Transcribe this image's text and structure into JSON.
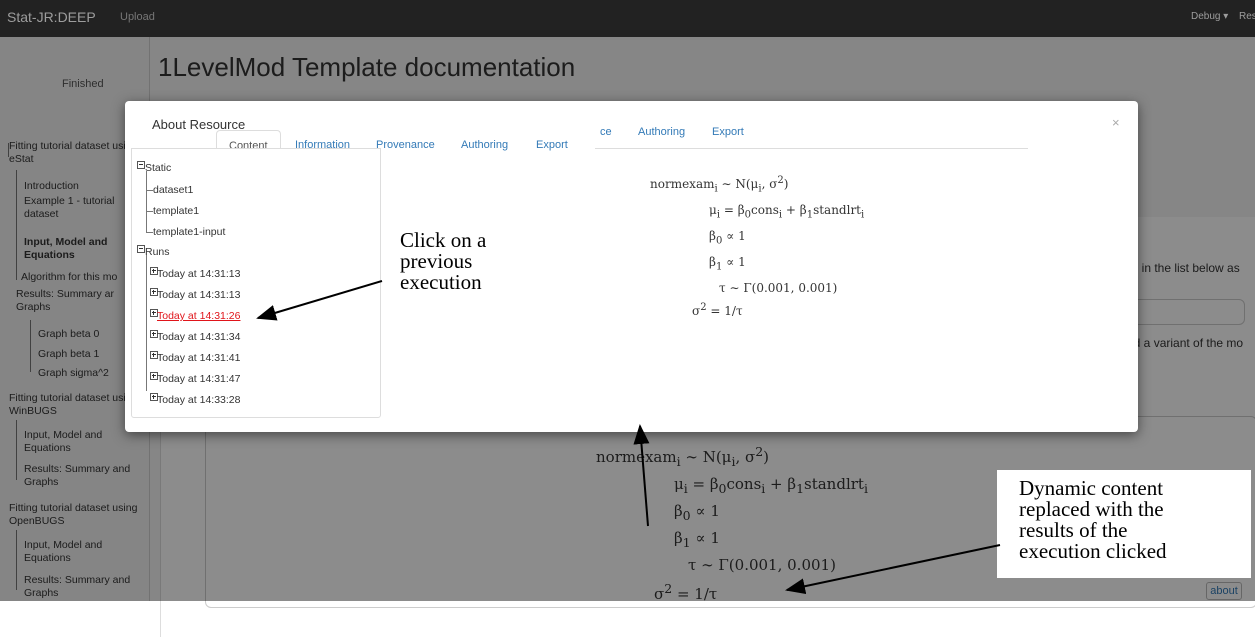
{
  "navbar": {
    "brand": "Stat-JR:DEEP",
    "upload": "Upload",
    "debug": "Debug ▾",
    "resources": "Reso"
  },
  "sidebar": {
    "status": "Finished",
    "items": [
      {
        "label": "Fitting tutorial dataset using eStat",
        "bold": false
      },
      {
        "label": "Introduction",
        "bold": false
      },
      {
        "label": "Example 1 - tutorial dataset",
        "bold": false
      },
      {
        "label": "Input, Model and Equations",
        "bold": true
      },
      {
        "label": "Algorithm for this mo",
        "bold": false
      },
      {
        "label": "Results: Summary ar Graphs",
        "bold": false
      },
      {
        "label": "Graph beta 0",
        "bold": false
      },
      {
        "label": "Graph beta 1",
        "bold": false
      },
      {
        "label": "Graph sigma^2",
        "bold": false
      },
      {
        "label": "Fitting tutorial dataset using WinBUGS",
        "bold": false
      },
      {
        "label": "Input, Model and Equations",
        "bold": false
      },
      {
        "label": "Results: Summary and Graphs",
        "bold": false
      },
      {
        "label": "Fitting tutorial dataset using OpenBUGS",
        "bold": false
      },
      {
        "label": "Input, Model and Equations",
        "bold": false
      },
      {
        "label": "Results: Summary and Graphs",
        "bold": false
      }
    ]
  },
  "main": {
    "title": "1LevelMod Template documentation",
    "right_text_1": "rt) in the list below as",
    "right_text_2": "nd a variant of the mo",
    "about_button": "about"
  },
  "modal": {
    "title": "About Resource",
    "close": "×",
    "tabs": [
      {
        "label": "Content",
        "active": true
      },
      {
        "label": "Information",
        "active": false
      },
      {
        "label": "Provenance",
        "active": false
      },
      {
        "label": "Authoring",
        "active": false
      },
      {
        "label": "Export",
        "active": false
      }
    ],
    "ghost_tabs": [
      "ce",
      "Authoring",
      "Export"
    ],
    "tree": {
      "static_label": "Static",
      "static_items": [
        "dataset1",
        "template1",
        "template1-input"
      ],
      "runs_label": "Runs",
      "runs": [
        {
          "label": "Today at 14:31:13",
          "selected": false
        },
        {
          "label": "Today at 14:31:13",
          "selected": false
        },
        {
          "label": "Today at 14:31:26",
          "selected": true
        },
        {
          "label": "Today at 14:31:34",
          "selected": false
        },
        {
          "label": "Today at 14:31:41",
          "selected": false
        },
        {
          "label": "Today at 14:31:47",
          "selected": false
        },
        {
          "label": "Today at 14:33:28",
          "selected": false
        }
      ]
    }
  },
  "equations": [
    "normexam<sub>i</sub> ∼ N(μ<sub>i</sub>, σ<sup>2</sup>)",
    "μ<sub>i</sub> = β<sub>0</sub>cons<sub>i</sub> + β<sub>1</sub>standlrt<sub>i</sub>",
    "β<sub>0</sub> ∝ 1",
    "β<sub>1</sub> ∝ 1",
    "τ ∼ Γ(0.001, 0.001)",
    "σ<sup>2</sup> = 1/τ"
  ],
  "annotations": {
    "click_previous": "Click on a\nprevious\nexecution",
    "dynamic_content": "Dynamic content\nreplaced with the\nresults of the\nexecution clicked"
  }
}
